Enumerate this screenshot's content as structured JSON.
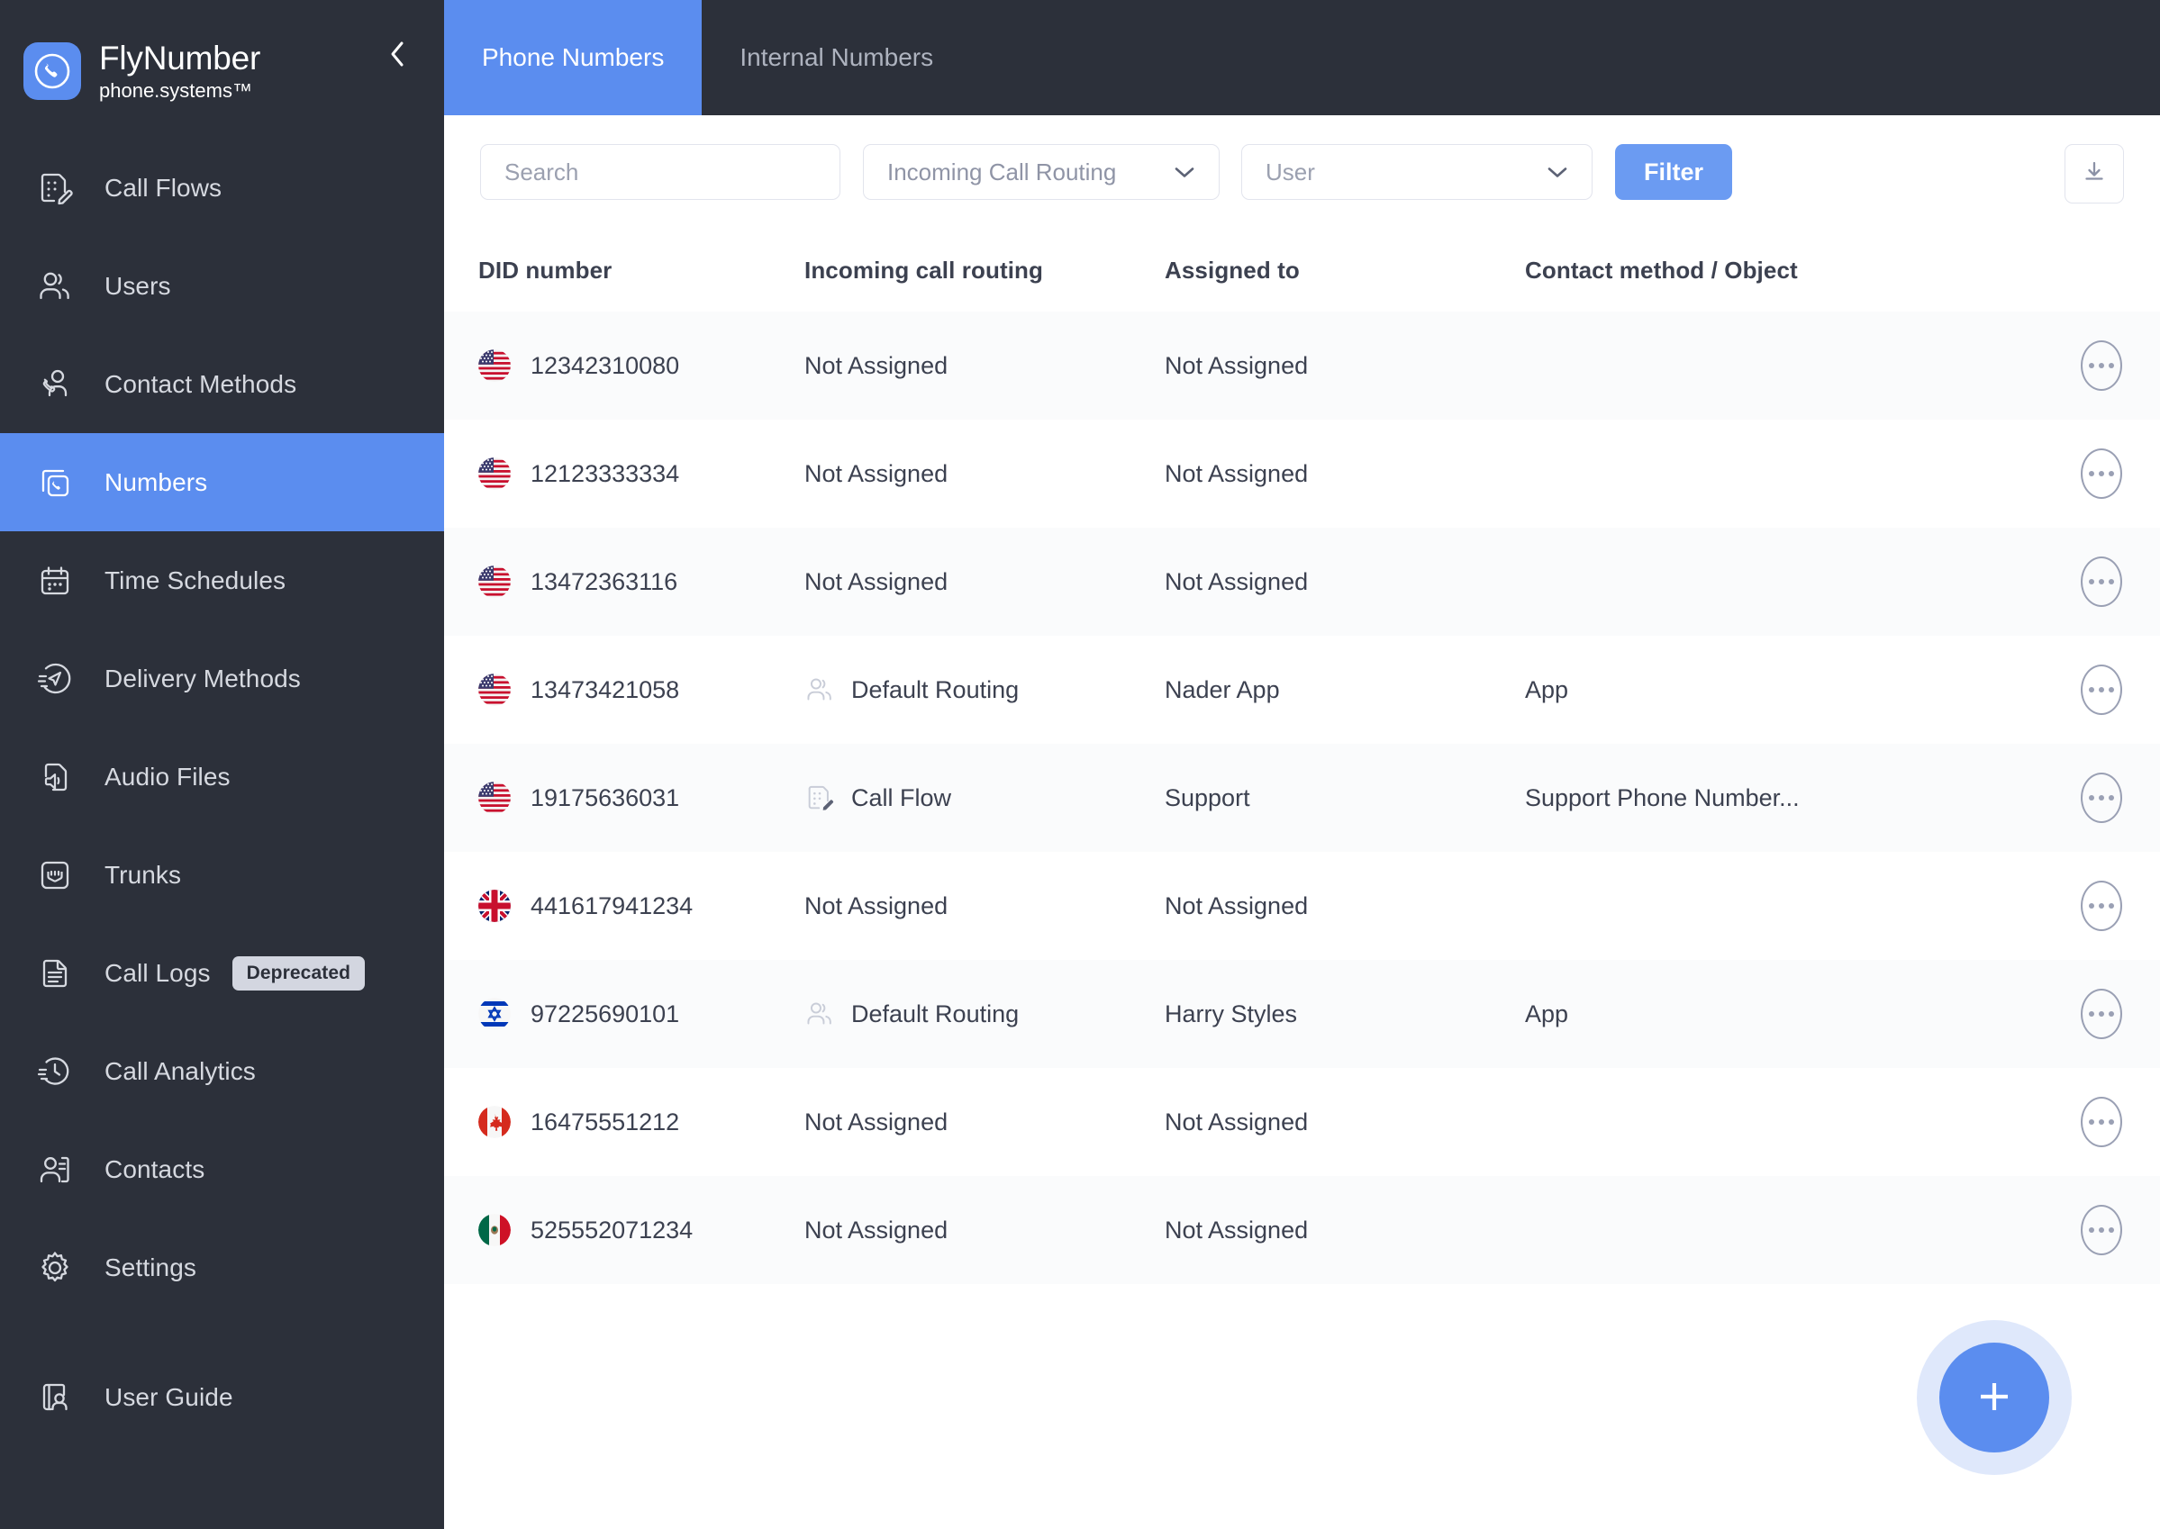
{
  "brand": {
    "title": "FlyNumber",
    "subtitle": "phone.systems™",
    "logo_icon": "phone-circle-icon",
    "collapse_icon": "chevron-left-icon"
  },
  "sidebar": {
    "items": [
      {
        "label": "Call Flows",
        "icon": "call-flow-icon",
        "key": "call-flows",
        "active": false
      },
      {
        "label": "Users",
        "icon": "users-icon",
        "key": "users",
        "active": false
      },
      {
        "label": "Contact Methods",
        "icon": "contact-method-icon",
        "key": "contact-methods",
        "active": false
      },
      {
        "label": "Numbers",
        "icon": "numbers-icon",
        "key": "numbers",
        "active": true
      },
      {
        "label": "Time Schedules",
        "icon": "calendar-icon",
        "key": "time-schedules",
        "active": false
      },
      {
        "label": "Delivery Methods",
        "icon": "paper-plane-icon",
        "key": "delivery-methods",
        "active": false
      },
      {
        "label": "Audio Files",
        "icon": "audio-file-icon",
        "key": "audio-files",
        "active": false
      },
      {
        "label": "Trunks",
        "icon": "trunk-icon",
        "key": "trunks",
        "active": false
      },
      {
        "label": "Call Logs",
        "icon": "document-icon",
        "key": "call-logs",
        "active": false,
        "badge": "Deprecated"
      },
      {
        "label": "Call Analytics",
        "icon": "clock-analytics-icon",
        "key": "call-analytics",
        "active": false
      },
      {
        "label": "Contacts",
        "icon": "contacts-icon",
        "key": "contacts",
        "active": false
      },
      {
        "label": "Settings",
        "icon": "gear-icon",
        "key": "settings",
        "active": false
      }
    ],
    "bottom": {
      "label": "User Guide",
      "icon": "user-guide-icon",
      "key": "user-guide"
    }
  },
  "tabs": [
    {
      "label": "Phone Numbers",
      "active": true
    },
    {
      "label": "Internal Numbers",
      "active": false
    }
  ],
  "toolbar": {
    "search_placeholder": "Search",
    "search_value": "",
    "routing_select": "Incoming Call Routing",
    "user_select": "User",
    "filter_label": "Filter",
    "download_icon": "download-icon",
    "chevron_icon": "chevron-down-icon"
  },
  "table": {
    "columns": [
      "DID number",
      "Incoming call routing",
      "Assigned to",
      "Contact method / Object"
    ],
    "rows": [
      {
        "flag": "us",
        "did": "12342310080",
        "routing": "Not Assigned",
        "routing_icon": "",
        "assigned": "Not Assigned",
        "contact": ""
      },
      {
        "flag": "us",
        "did": "12123333334",
        "routing": "Not Assigned",
        "routing_icon": "",
        "assigned": "Not Assigned",
        "contact": ""
      },
      {
        "flag": "us",
        "did": "13472363116",
        "routing": "Not Assigned",
        "routing_icon": "",
        "assigned": "Not Assigned",
        "contact": ""
      },
      {
        "flag": "us",
        "did": "13473421058",
        "routing": "Default Routing",
        "routing_icon": "users-icon",
        "assigned": "Nader App",
        "contact": "App"
      },
      {
        "flag": "us",
        "did": "19175636031",
        "routing": "Call Flow",
        "routing_icon": "call-flow-icon",
        "assigned": "Support",
        "contact": "Support Phone Number..."
      },
      {
        "flag": "gb",
        "did": "441617941234",
        "routing": "Not Assigned",
        "routing_icon": "",
        "assigned": "Not Assigned",
        "contact": ""
      },
      {
        "flag": "il",
        "did": "97225690101",
        "routing": "Default Routing",
        "routing_icon": "users-icon",
        "assigned": "Harry Styles",
        "contact": "App"
      },
      {
        "flag": "ca",
        "did": "16475551212",
        "routing": "Not Assigned",
        "routing_icon": "",
        "assigned": "Not Assigned",
        "contact": ""
      },
      {
        "flag": "mx",
        "did": "525552071234",
        "routing": "Not Assigned",
        "routing_icon": "",
        "assigned": "Not Assigned",
        "contact": ""
      }
    ],
    "row_menu_icon": "ellipsis-icon"
  },
  "fab": {
    "icon": "plus-icon",
    "label": "Add number"
  },
  "colors": {
    "sidebar_bg": "#2c303a",
    "accent": "#5b8def",
    "accent_button": "#6b9bf2",
    "row_alt": "#fafbfc",
    "text_primary": "#3c4150",
    "placeholder": "#9ba0b0",
    "badge_bg": "#d3d6e0"
  }
}
